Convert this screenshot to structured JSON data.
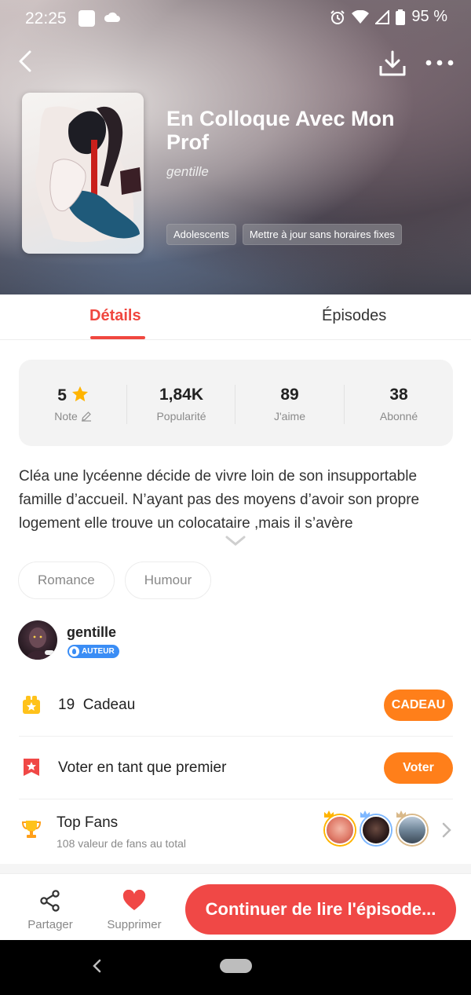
{
  "status_bar": {
    "time": "22:25",
    "battery": "95 %"
  },
  "book": {
    "title": "En Colloque Avec Mon Prof",
    "author": "gentille",
    "tags": [
      "Adolescents",
      "Mettre à jour sans horaires fixes"
    ]
  },
  "tabs": [
    {
      "label": "Détails",
      "active": true
    },
    {
      "label": "Épisodes",
      "active": false
    }
  ],
  "stats": [
    {
      "value": "5",
      "label": "Note",
      "icon": "star-icon"
    },
    {
      "value": "1,84K",
      "label": "Popularité"
    },
    {
      "value": "89",
      "label": "J'aime"
    },
    {
      "value": "38",
      "label": "Abonné"
    }
  ],
  "synopsis": "Cléa une lycéenne décide de vivre loin de son insupportable famille d’accueil. N’ayant pas des moyens d’avoir son propre logement elle trouve un colocataire ,mais il s’avère",
  "genres": [
    "Romance",
    "Humour"
  ],
  "author_block": {
    "name": "gentille",
    "badge": "AUTEUR"
  },
  "gift_row": {
    "count": "19",
    "label": "Cadeau",
    "button": "CADEAU"
  },
  "vote_row": {
    "label": "Voter en tant que premier",
    "button": "Voter"
  },
  "fans_row": {
    "title": "Top Fans",
    "subtitle": "108 valeur de fans au total"
  },
  "bottom_bar": {
    "share_label": "Partager",
    "delete_label": "Supprimer",
    "cta": "Continuer de lire l'épisode..."
  },
  "colors": {
    "accent": "#f0473f",
    "orange": "#ff7f1a",
    "badge_blue": "#3a8df5",
    "gift_yellow": "#ffc21a"
  }
}
